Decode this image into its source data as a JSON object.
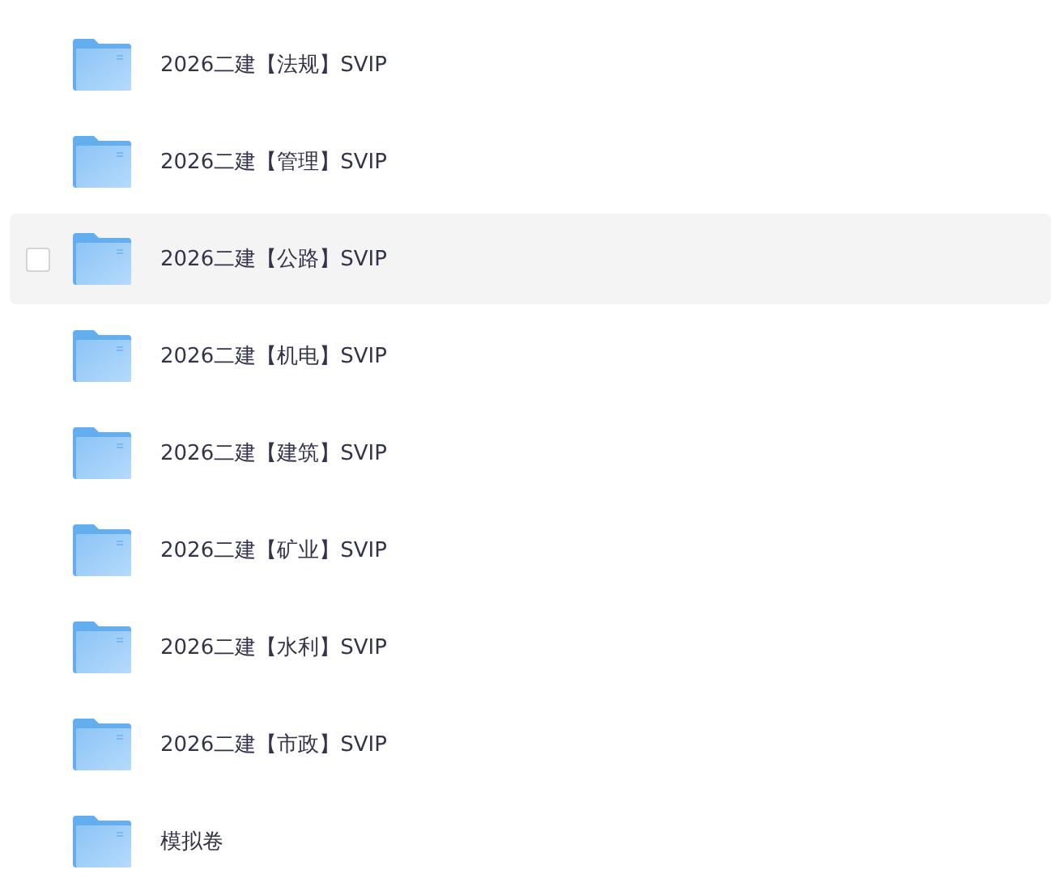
{
  "folders": [
    {
      "name": "2026二建【法规】SVIP",
      "hovered": false,
      "checked": false
    },
    {
      "name": "2026二建【管理】SVIP",
      "hovered": false,
      "checked": false
    },
    {
      "name": "2026二建【公路】SVIP",
      "hovered": true,
      "checked": false
    },
    {
      "name": "2026二建【机电】SVIP",
      "hovered": false,
      "checked": false
    },
    {
      "name": "2026二建【建筑】SVIP",
      "hovered": false,
      "checked": false
    },
    {
      "name": "2026二建【矿业】SVIP",
      "hovered": false,
      "checked": false
    },
    {
      "name": "2026二建【水利】SVIP",
      "hovered": false,
      "checked": false
    },
    {
      "name": "2026二建【市政】SVIP",
      "hovered": false,
      "checked": false
    },
    {
      "name": "模拟卷",
      "hovered": false,
      "checked": false
    }
  ]
}
